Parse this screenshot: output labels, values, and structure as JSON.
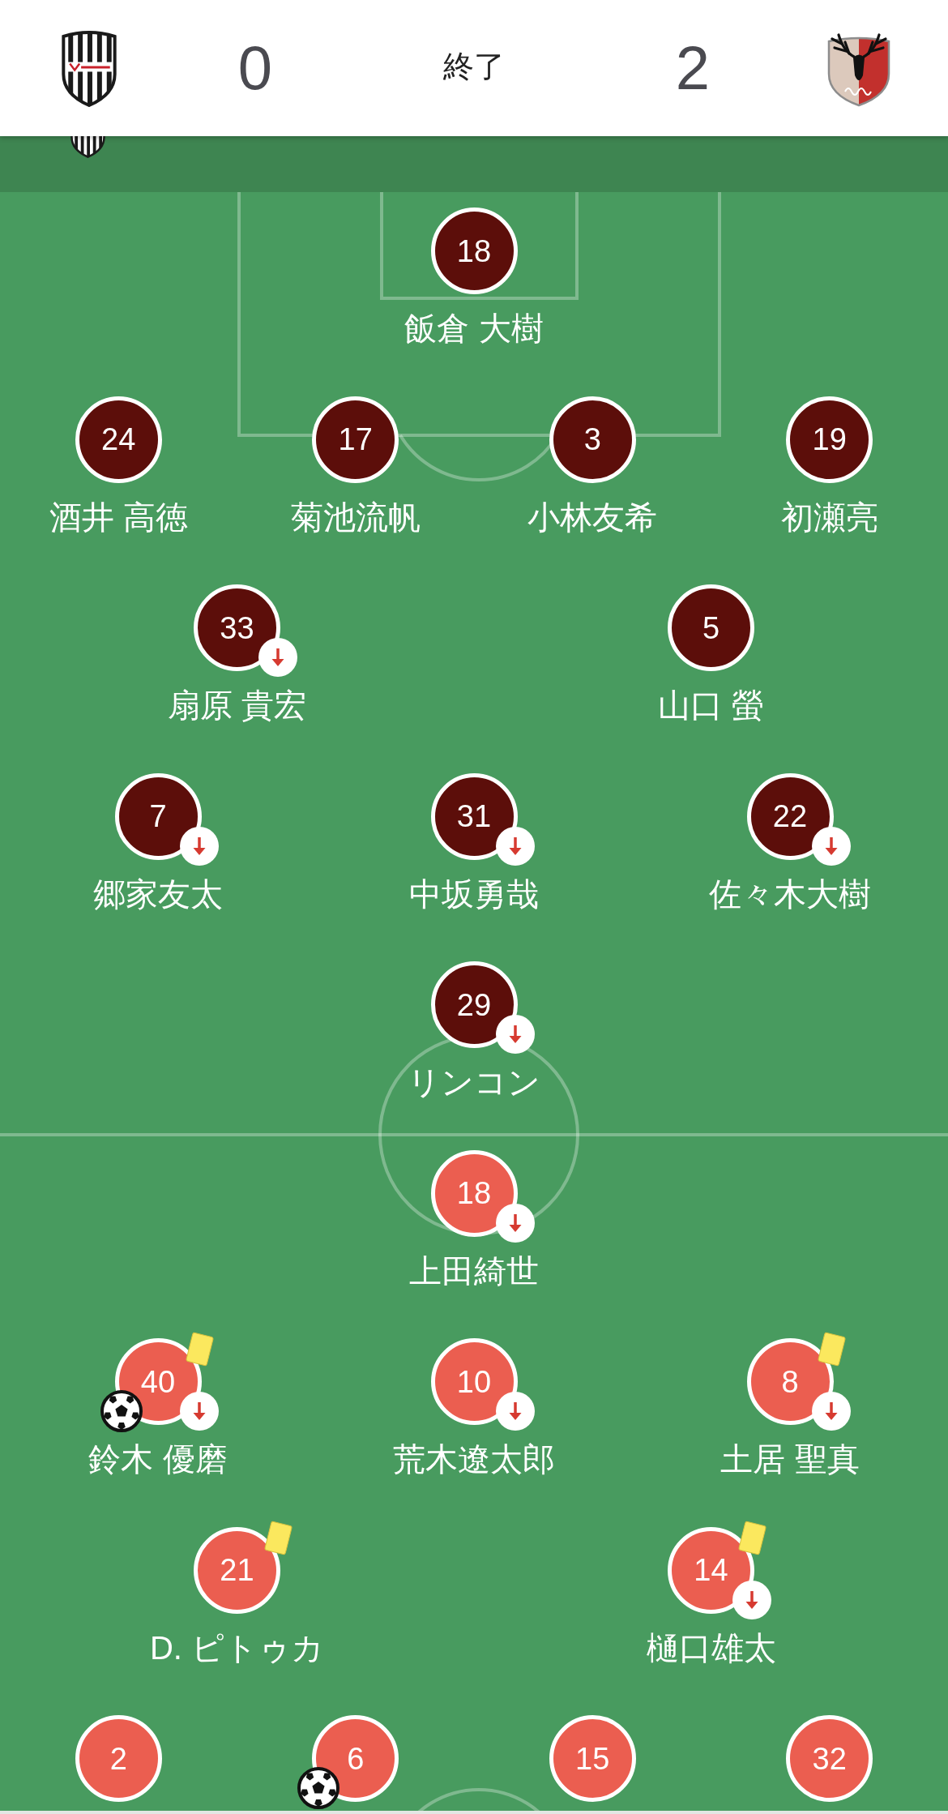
{
  "header": {
    "home_score": "0",
    "status": "終了",
    "away_score": "2"
  },
  "teams": [
    {
      "color": "#5c0e0a",
      "rows": [
        {
          "players": [
            {
              "number": "18",
              "name": "飯倉 大樹",
              "substituted": false,
              "yellow_card": false,
              "goal": false
            }
          ]
        },
        {
          "players": [
            {
              "number": "24",
              "name": "酒井 高徳",
              "substituted": false,
              "yellow_card": false,
              "goal": false
            },
            {
              "number": "17",
              "name": "菊池流帆",
              "substituted": false,
              "yellow_card": false,
              "goal": false
            },
            {
              "number": "3",
              "name": "小林友希",
              "substituted": false,
              "yellow_card": false,
              "goal": false
            },
            {
              "number": "19",
              "name": "初瀬亮",
              "substituted": false,
              "yellow_card": false,
              "goal": false
            }
          ]
        },
        {
          "players": [
            {
              "number": "33",
              "name": "扇原 貴宏",
              "substituted": true,
              "yellow_card": false,
              "goal": false
            },
            {
              "number": "5",
              "name": "山口 螢",
              "substituted": false,
              "yellow_card": false,
              "goal": false
            }
          ]
        },
        {
          "players": [
            {
              "number": "7",
              "name": "郷家友太",
              "substituted": true,
              "yellow_card": false,
              "goal": false
            },
            {
              "number": "31",
              "name": "中坂勇哉",
              "substituted": true,
              "yellow_card": false,
              "goal": false
            },
            {
              "number": "22",
              "name": "佐々木大樹",
              "substituted": true,
              "yellow_card": false,
              "goal": false
            }
          ]
        },
        {
          "players": [
            {
              "number": "29",
              "name": "リンコン",
              "substituted": true,
              "yellow_card": false,
              "goal": false
            }
          ]
        }
      ]
    },
    {
      "color": "#eb5e50",
      "rows": [
        {
          "players": [
            {
              "number": "18",
              "name": "上田綺世",
              "substituted": true,
              "yellow_card": false,
              "goal": false
            }
          ]
        },
        {
          "players": [
            {
              "number": "40",
              "name": "鈴木 優磨",
              "substituted": true,
              "yellow_card": true,
              "goal": true
            },
            {
              "number": "10",
              "name": "荒木遼太郎",
              "substituted": true,
              "yellow_card": false,
              "goal": false
            },
            {
              "number": "8",
              "name": "土居 聖真",
              "substituted": true,
              "yellow_card": true,
              "goal": false
            }
          ]
        },
        {
          "players": [
            {
              "number": "21",
              "name": "D. ピトゥカ",
              "substituted": false,
              "yellow_card": true,
              "goal": false
            },
            {
              "number": "14",
              "name": "樋口雄太",
              "substituted": true,
              "yellow_card": true,
              "goal": false
            }
          ]
        },
        {
          "players": [
            {
              "number": "2",
              "substituted": false,
              "yellow_card": false,
              "goal": false
            },
            {
              "number": "6",
              "substituted": false,
              "yellow_card": false,
              "goal": true
            },
            {
              "number": "15",
              "substituted": false,
              "yellow_card": false,
              "goal": false
            },
            {
              "number": "32",
              "substituted": false,
              "yellow_card": false,
              "goal": false
            }
          ]
        }
      ]
    }
  ]
}
